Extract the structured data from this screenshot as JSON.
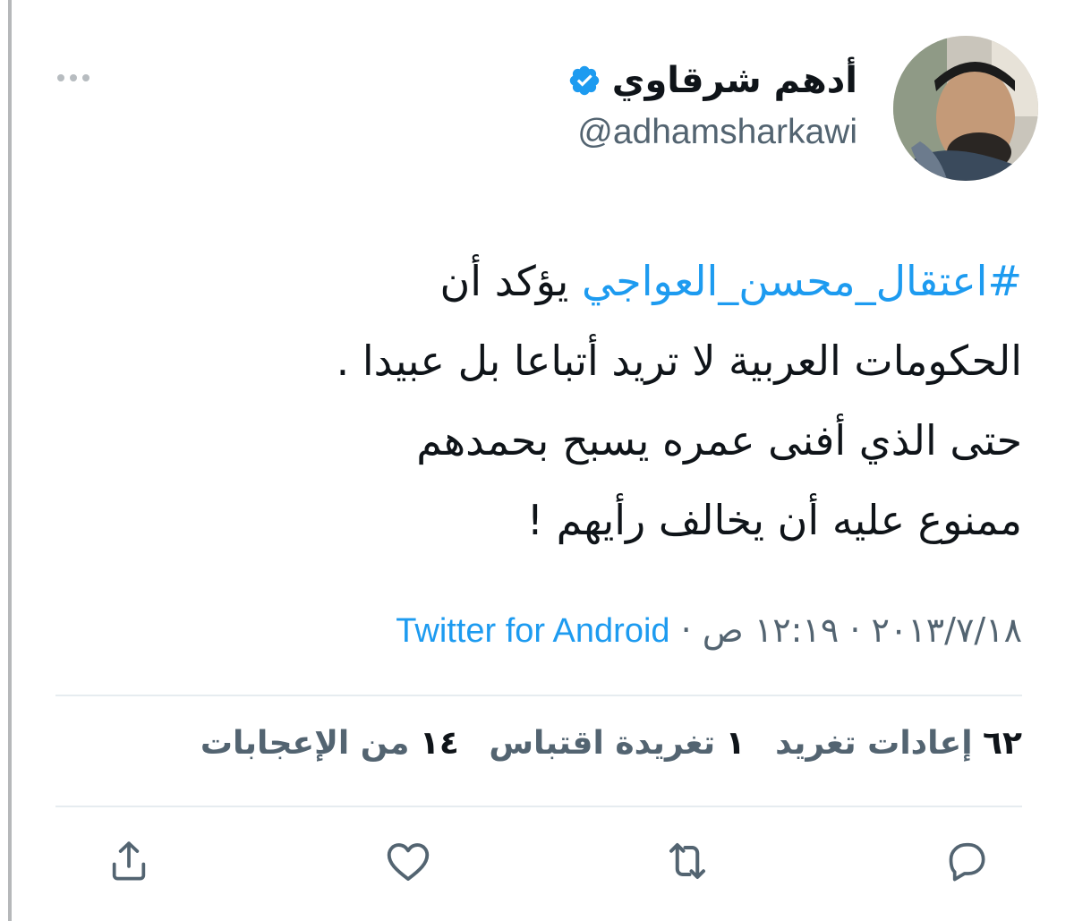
{
  "author": {
    "display_name": "أدهم شرقاوي",
    "handle": "@adhamsharkawi",
    "verified_icon": "verified-badge-icon",
    "avatar_icon": "avatar"
  },
  "tweet": {
    "hashtag": "#اعتقال_محسن_العواجي",
    "text_after_hashtag": " يؤكد أن",
    "lines": [
      "الحكومات العربية لا تريد أتباعا بل عبيدا .",
      "حتى الذي أفنى عمره يسبح بحمدهم",
      "ممنوع عليه أن يخالف رأيهم !"
    ]
  },
  "meta": {
    "date": "٢٠١٣/٧/١٨",
    "separator": " · ",
    "time": "١٢:١٩ ص",
    "source": "Twitter for Android"
  },
  "stats": {
    "retweets_count": "٦٢",
    "retweets_label": "إعادات تغريد",
    "quotes_count": "١",
    "quotes_label": "تغريدة اقتباس",
    "likes_count": "١٤",
    "likes_label": "من الإعجابات"
  },
  "actions": [
    "reply-icon",
    "retweet-icon",
    "like-icon",
    "share-icon"
  ],
  "colors": {
    "accent": "#1d9bf0",
    "text": "#0f1419",
    "secondary": "#536471",
    "divider": "#e6ecf0"
  }
}
